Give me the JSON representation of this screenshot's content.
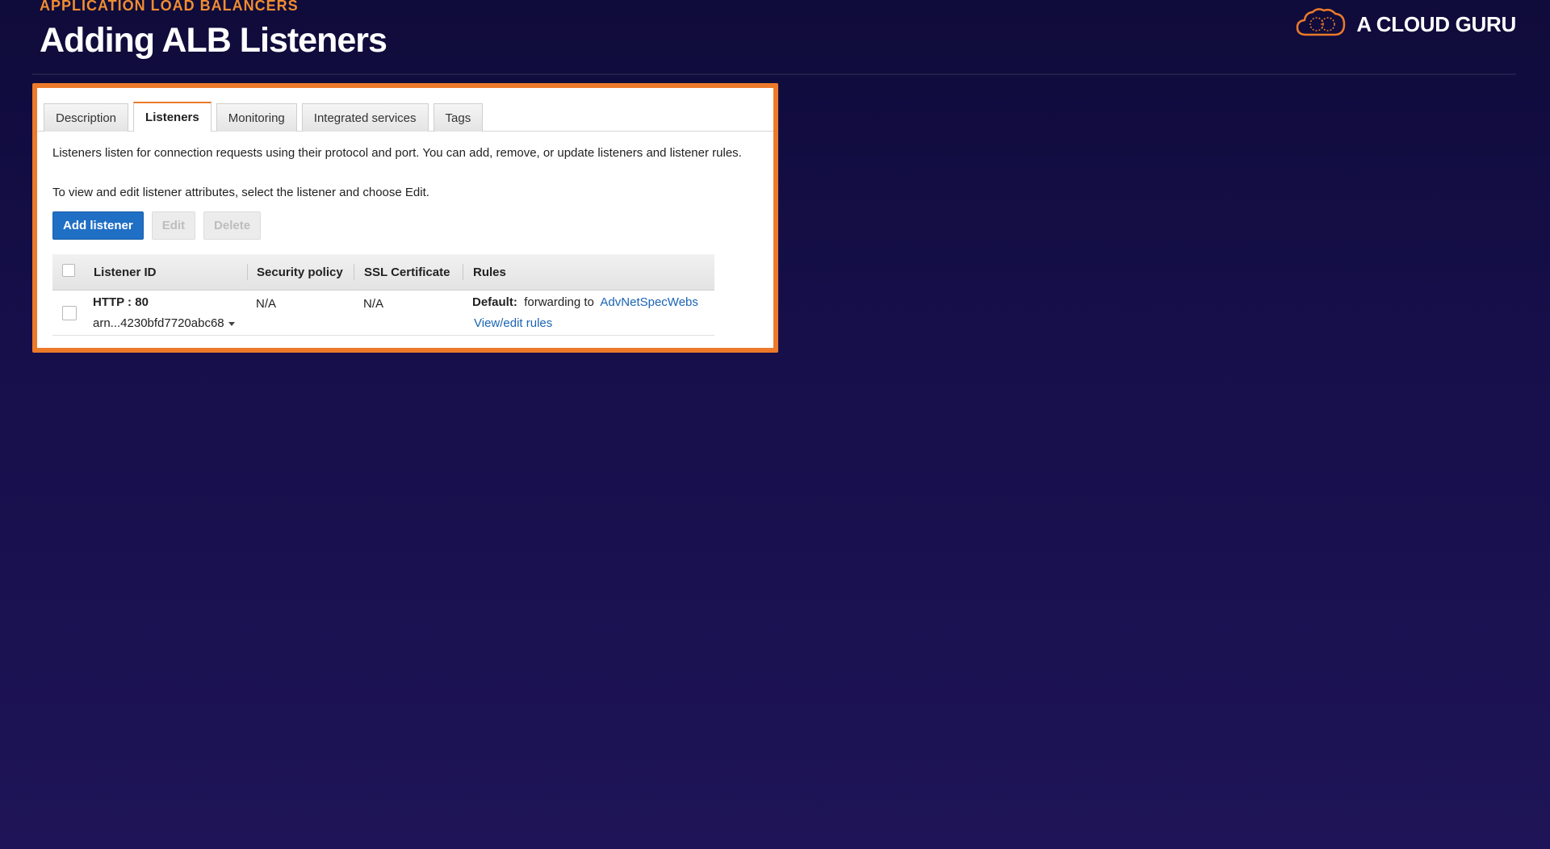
{
  "header": {
    "eyebrow": "APPLICATION LOAD BALANCERS",
    "title": "Adding ALB Listeners",
    "brand": "A CLOUD GURU"
  },
  "colors": {
    "accent": "#ec7a2a",
    "primary_button": "#1f6fc5",
    "link": "#1a64b4"
  },
  "tabs": [
    {
      "label": "Description",
      "active": false
    },
    {
      "label": "Listeners",
      "active": true
    },
    {
      "label": "Monitoring",
      "active": false
    },
    {
      "label": "Integrated services",
      "active": false
    },
    {
      "label": "Tags",
      "active": false
    }
  ],
  "content": {
    "description": "Listeners listen for connection requests using their protocol and port. You can add, remove, or update listeners and listener rules.",
    "instructions": "To view and edit listener attributes, select the listener and choose Edit."
  },
  "buttons": {
    "add": "Add listener",
    "edit": "Edit",
    "delete": "Delete"
  },
  "table": {
    "columns": [
      "Listener ID",
      "Security policy",
      "SSL Certificate",
      "Rules"
    ],
    "rows": [
      {
        "listener": "HTTP : 80",
        "arn": "arn...4230bfd7720abc68",
        "security_policy": "N/A",
        "ssl_certificate": "N/A",
        "rules_default_label": "Default:",
        "rules_forwarding": "forwarding to",
        "rules_target": "AdvNetSpecWebs",
        "rules_link": "View/edit rules"
      }
    ]
  }
}
